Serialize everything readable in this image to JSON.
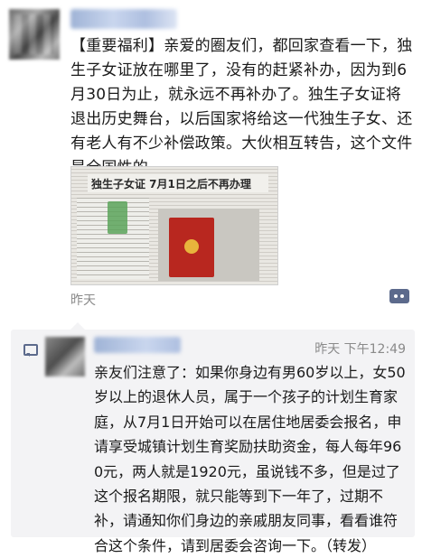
{
  "post": {
    "text": "【重要福利】亲爱的圈友们，都回家查看一下，独生子女证放在哪里了，没有的赶紧补办，因为到6月30日为止，就永远不再补办了。独生子女证将退出历史舞台，以后国家将给这一代独生子女、还有老人有不少补偿政策。大伙相互转告，这个文件是全国性的。",
    "image_headline": "独生子女证 7月1日之后不再办理",
    "time": "昨天"
  },
  "comment": {
    "time": "昨天 下午12:49",
    "text": "亲友们注意了：如果你身边有男60岁以上，女50岁以上的退休人员，属于一个孩子的计划生育家庭，从7月1日开始可以在居住地居委会报名，申请享受城镇计划生育奖励扶助资金，每人每年960元，两人就是1920元，虽说钱不多，但是过了这个报名期限，就只能等到下一年了，过期不补，请通知你们身边的亲戚朋友同事，看看谁符合这个条件，请到居委会咨询一下。（转发）"
  },
  "colors": {
    "link": "#5c6a8c",
    "meta": "#8a8a8a",
    "comment_bg": "#f3f3f5"
  }
}
